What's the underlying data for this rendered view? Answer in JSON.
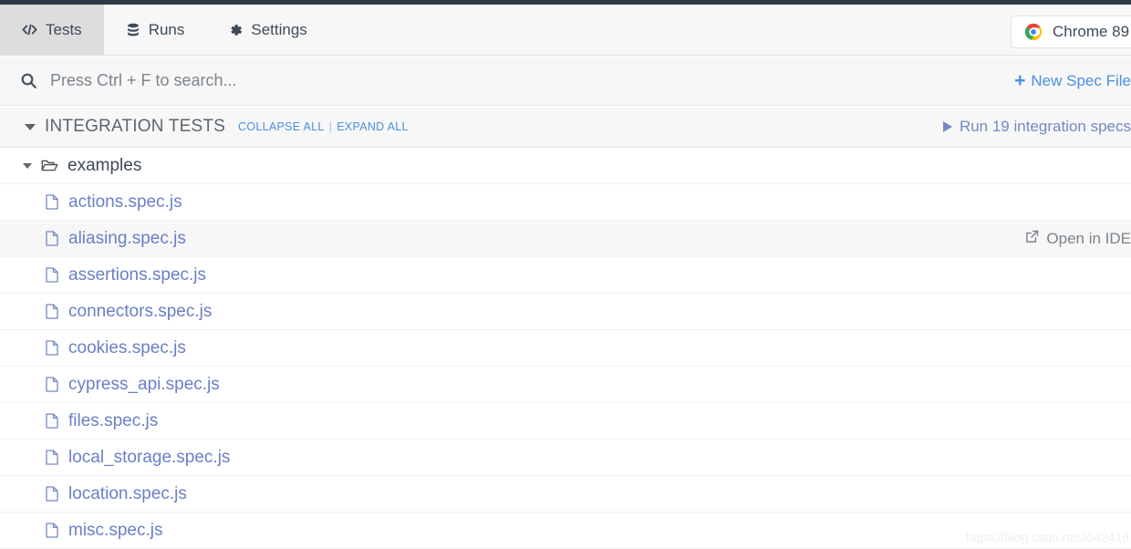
{
  "window": {
    "top_strip_color": "#2c3a47"
  },
  "tabs": [
    {
      "label": "Tests",
      "icon": "code-icon",
      "active": true
    },
    {
      "label": "Runs",
      "icon": "database-icon",
      "active": false
    },
    {
      "label": "Settings",
      "icon": "gear-icon",
      "active": false
    }
  ],
  "browser_selector": {
    "label": "Chrome 89",
    "icon": "chrome-logo-icon"
  },
  "search": {
    "placeholder": "Press Ctrl + F to search...",
    "value": "",
    "icon": "search-icon"
  },
  "new_spec": {
    "label": "New Spec File",
    "icon": "plus-icon",
    "color": "#4a90e2"
  },
  "section": {
    "title": "INTEGRATION TESTS",
    "collapse_all": "COLLAPSE ALL",
    "separator": "|",
    "expand_all": "EXPAND ALL",
    "run_specs": "Run 19 integration specs",
    "run_icon": "play-icon",
    "caret_icon": "caret-down-icon"
  },
  "folder": {
    "name": "examples",
    "icon": "folder-open-icon",
    "caret_icon": "caret-down-icon"
  },
  "files": [
    {
      "name": "actions.spec.js",
      "icon": "file-icon",
      "hovered": false
    },
    {
      "name": "aliasing.spec.js",
      "icon": "file-icon",
      "hovered": true
    },
    {
      "name": "assertions.spec.js",
      "icon": "file-icon",
      "hovered": false
    },
    {
      "name": "connectors.spec.js",
      "icon": "file-icon",
      "hovered": false
    },
    {
      "name": "cookies.spec.js",
      "icon": "file-icon",
      "hovered": false
    },
    {
      "name": "cypress_api.spec.js",
      "icon": "file-icon",
      "hovered": false
    },
    {
      "name": "files.spec.js",
      "icon": "file-icon",
      "hovered": false
    },
    {
      "name": "local_storage.spec.js",
      "icon": "file-icon",
      "hovered": false
    },
    {
      "name": "location.spec.js",
      "icon": "file-icon",
      "hovered": false
    },
    {
      "name": "misc.spec.js",
      "icon": "file-icon",
      "hovered": false
    }
  ],
  "open_in_ide": {
    "label": "Open in IDE",
    "icon": "external-link-icon"
  },
  "watermark": {
    "text": "https://blog.csdn.net/i042416"
  },
  "colors": {
    "accent_blue": "#4a90e2",
    "file_link": "#6a7fc7",
    "active_tab_bg": "#dddddd",
    "bar_bg": "#f7f7f7"
  }
}
